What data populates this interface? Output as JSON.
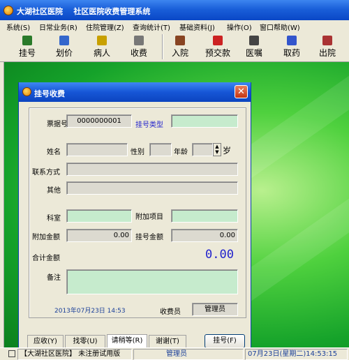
{
  "window": {
    "title": "大湖社区医院    社区医院收费管理系统"
  },
  "menu": {
    "items": [
      "系统(S)",
      "日常业务(R)",
      "住院管理(Z)",
      "查询统计(T)",
      "基础资料(J)",
      "操作(O)",
      "窗口帮助(W)"
    ]
  },
  "toolbar": {
    "left": [
      {
        "label": "挂号",
        "icon": "register-icon",
        "color": "#2a7a2a"
      },
      {
        "label": "划价",
        "icon": "pricing-icon",
        "color": "#3366cc"
      },
      {
        "label": "病人",
        "icon": "patient-icon",
        "color": "#c8a000"
      },
      {
        "label": "收费",
        "icon": "charge-icon",
        "color": "#777777"
      }
    ],
    "right": [
      {
        "label": "入院",
        "icon": "admission-icon",
        "color": "#884422"
      },
      {
        "label": "预交款",
        "icon": "prepay-icon",
        "color": "#cc2222"
      },
      {
        "label": "医嘱",
        "icon": "doctor-order-icon",
        "color": "#444444"
      },
      {
        "label": "取药",
        "icon": "dispense-icon",
        "color": "#3355cc"
      },
      {
        "label": "出院",
        "icon": "discharge-icon",
        "color": "#aa3333"
      }
    ]
  },
  "dialog": {
    "title": "挂号收费",
    "close": "✕",
    "receipt_label": "票据号",
    "receipt_value": "0000000001",
    "reg_type_label": "挂号类型",
    "reg_type_value": "",
    "name_label": "姓名",
    "gender_label": "性别",
    "age_label": "年龄",
    "age_unit": "岁",
    "contact_label": "联系方式",
    "other_label": "其他",
    "dept_label": "科室",
    "extra_item_label": "附加项目",
    "extra_amount_label": "附加金额",
    "extra_amount_value": "0.00",
    "reg_amount_label": "挂号金额",
    "reg_amount_value": "0.00",
    "total_label": "合计金额",
    "total_value": "0.00",
    "remark_label": "备注",
    "datetime": "2013年07月23日   14:53",
    "cashier_label": "收费员",
    "cashier_value": "管理员",
    "tabs": [
      "应收(Y)",
      "找零(U)",
      "请稍等(R)",
      "谢谢(T)"
    ],
    "register_button": "挂号(F)"
  },
  "status": {
    "hospital": "【大湖社区医院】 未注册试用版",
    "user": "管理员",
    "datetime": "07月23日(星期二)14:53:15"
  },
  "colors": {
    "accent_blue": "#2222cc",
    "field_green": "#c6ebcd",
    "title_blue": "#1a5fd9"
  }
}
